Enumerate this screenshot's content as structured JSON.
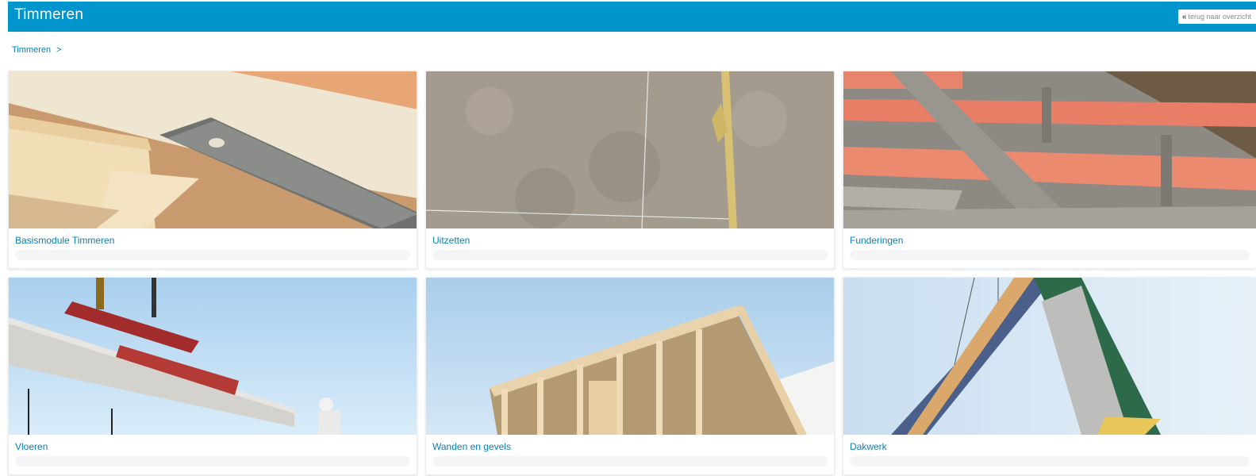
{
  "header": {
    "title": "Timmeren",
    "back_label": "terug naar overzicht"
  },
  "breadcrumb": {
    "items": [
      "Timmeren"
    ],
    "separator": ">"
  },
  "modules": [
    {
      "title": "Basismodule Timmeren",
      "image": "wood-and-saw"
    },
    {
      "title": "Uitzetten",
      "image": "sand-with-string-lines"
    },
    {
      "title": "Funderingen",
      "image": "foundation-formwork"
    },
    {
      "title": "Vloeren",
      "image": "crane-lifting-floor-slab"
    },
    {
      "title": "Wanden en gevels",
      "image": "timber-frame-wall"
    },
    {
      "title": "Dakwerk",
      "image": "roof-element-lifted"
    }
  ],
  "colors": {
    "header": "#0095cc",
    "link": "#0a7fb4"
  }
}
